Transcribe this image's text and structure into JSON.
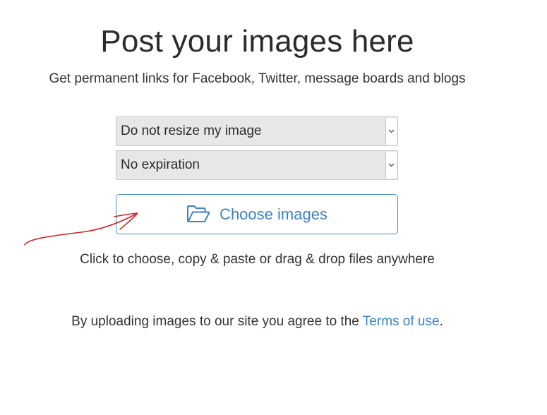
{
  "header": {
    "title": "Post your images here",
    "subtitle": "Get permanent links for Facebook, Twitter, message boards and blogs"
  },
  "form": {
    "resize_select": {
      "selected": "Do not resize my image"
    },
    "expiration_select": {
      "selected": "No expiration"
    },
    "choose_button": {
      "label": "Choose images",
      "icon": "folder-open-icon"
    },
    "hint": "Click to choose, copy & paste or drag & drop files anywhere"
  },
  "footer": {
    "terms_prefix": "By uploading images to our site you agree to the ",
    "terms_link": "Terms of use",
    "terms_suffix": "."
  },
  "colors": {
    "accent": "#3f83c1",
    "annotation_arrow": "#d42020",
    "select_bg": "#e7e7e7"
  }
}
